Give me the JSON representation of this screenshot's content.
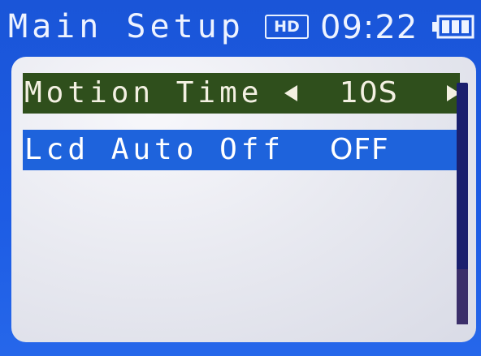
{
  "header": {
    "title": "Main Setup",
    "hd_badge": "HD",
    "time": "09:22",
    "battery_icon": "battery-full-icon"
  },
  "menu": {
    "items": [
      {
        "label": "Motion Time",
        "value": "10S",
        "selected": true,
        "left_arrow_icon": "arrow-left-icon",
        "right_arrow_icon": "arrow-right-icon"
      },
      {
        "label": "Lcd Auto Off",
        "value": "OFF",
        "selected": false
      }
    ]
  },
  "colors": {
    "background_blue": "#1d5ce4",
    "selected_row": "#2f4f1c",
    "highlight_row": "#1e63dc",
    "panel": "#e9eaf1",
    "scrollbar": "#1a1f6e"
  }
}
